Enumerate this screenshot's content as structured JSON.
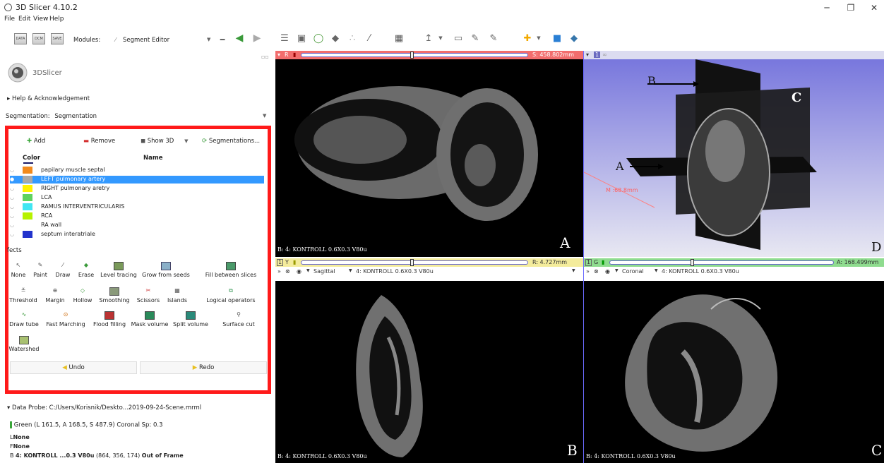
{
  "app": {
    "title": "3D Slicer 4.10.2"
  },
  "menu": [
    "File",
    "Edit",
    "View",
    "Help"
  ],
  "toolbar": {
    "data_label": "DATA",
    "dcm_label": "DCM",
    "save_label": "SAVE",
    "modules_label": "Modules:",
    "module_selected": "Segment Editor"
  },
  "logo": {
    "text": "3DSlicer"
  },
  "help": {
    "label": "Help & Acknowledgement"
  },
  "segmentation": {
    "label": "Segmentation:",
    "value": "Segmentation"
  },
  "segment_buttons": {
    "add": "Add",
    "remove": "Remove",
    "show3d": "Show 3D",
    "segmentations": "Segmentations..."
  },
  "segment_table": {
    "color_header": "Color",
    "name_header": "Name",
    "rows": [
      {
        "name": "papilary muscle septal",
        "color": "#f28a1c"
      },
      {
        "name": "LEFT pulmonary artery",
        "color": "#a9a9a9"
      },
      {
        "name": "RIGHT pulmonary aretry",
        "color": "#fff200"
      },
      {
        "name": "LCA",
        "color": "#5fd35f"
      },
      {
        "name": "RAMUS INTERVENTRICULARIS",
        "color": "#41e6f2"
      },
      {
        "name": "RCA",
        "color": "#b6f200"
      },
      {
        "name": "RA wall",
        "color": "#ffffff"
      },
      {
        "name": "septum interatriale",
        "color": "#2233cc"
      }
    ]
  },
  "effects": {
    "label": "fects",
    "items": [
      "None",
      "Paint",
      "Draw",
      "Erase",
      "Level tracing",
      "Grow from seeds",
      "Fill between slices",
      "Threshold",
      "Margin",
      "Hollow",
      "Smoothing",
      "Scissors",
      "Islands",
      "Logical operators",
      "Draw tube",
      "Fast Marching",
      "Flood filling",
      "Mask volume",
      "Split volume",
      "Surface cut",
      "Watershed"
    ]
  },
  "history": {
    "undo": "Undo",
    "redo": "Redo"
  },
  "probe": {
    "title": "Data Probe: C:/Users/Korisnik/Deskto...2019-09-24-Scene.mrml",
    "green_line": "Green   (L 161.5, A 168.5, S 487.9)  Coronal Sp: 0.3",
    "l_prefix": "L",
    "l_value": "None",
    "f_prefix": "F",
    "f_value": "None",
    "b_prefix": "B",
    "b_bold": "4: KONTROLL ...0.3 V80u",
    "b_coords": "(864, 356, 174)",
    "b_status": "Out of Frame"
  },
  "views": {
    "red": {
      "letter": "R",
      "value": "S: 458.802mm",
      "label": "B: 4: KONTROLL  0.6X0.3  V80u",
      "corner": "A",
      "slider_pos": 0.48
    },
    "threed": {
      "num": "1",
      "corner": "D",
      "marks": {
        "a": "A",
        "b": "B",
        "c": "C"
      },
      "ruler": "M :68.8mm"
    },
    "yellow": {
      "num": "1",
      "letter": "Y",
      "value": "R: 4.727mm",
      "orient": "Sagittal",
      "volume": "4: KONTROLL  0.6X0.3  V80u",
      "label": "B: 4: KONTROLL  0.6X0.3  V80u",
      "corner": "B",
      "slider_pos": 0.48
    },
    "green": {
      "num": "1",
      "letter": "G",
      "value": "A: 168.499mm",
      "orient": "Coronal",
      "volume": "4: KONTROLL  0.6X0.3  V80u",
      "label": "B: 4: KONTROLL  0.6X0.3  V80u",
      "corner": "C",
      "slider_pos": 0.36
    }
  },
  "colors": {
    "red_bar": "#f26d6d",
    "yellow_bar": "#f4ec9c",
    "green_bar": "#8fdc8f",
    "highlight": "#ff1a1a",
    "select": "#3399ff"
  }
}
